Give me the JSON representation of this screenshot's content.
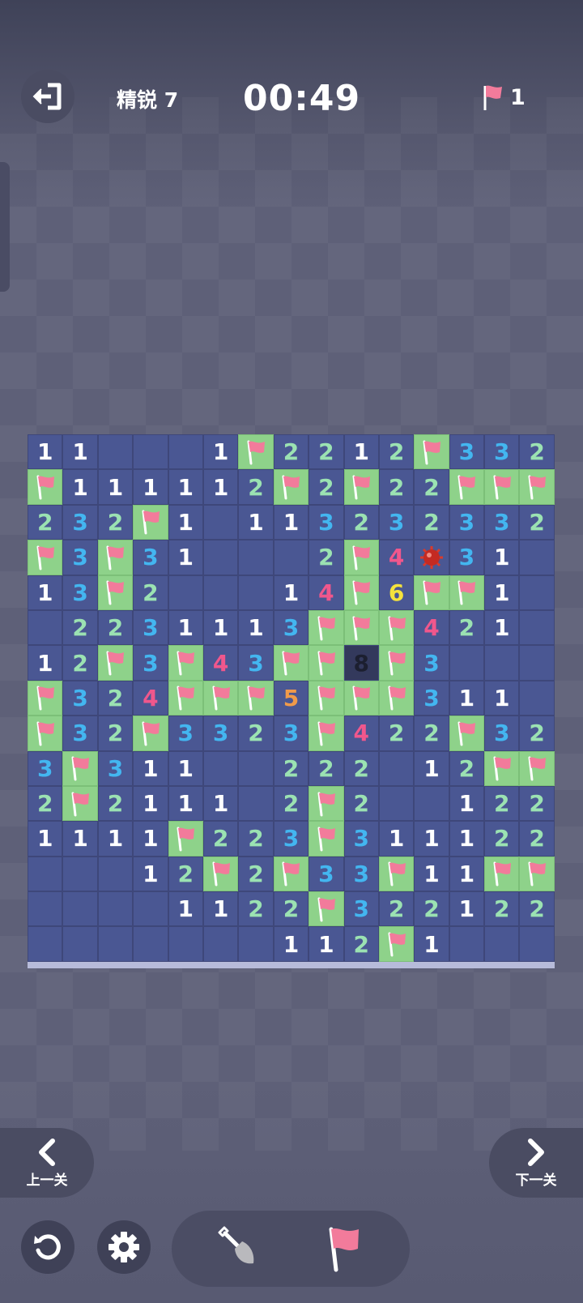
{
  "header": {
    "level_label": "精锐 7",
    "timer": "00:49",
    "flag_count": "1"
  },
  "nav": {
    "prev_label": "上一关",
    "next_label": "下一关"
  },
  "colors": {
    "board": "#4a5793",
    "flag_cell": "#8ed28a",
    "n1": "#ffffff",
    "n2": "#9be2b2",
    "n3": "#43b6f0",
    "n4": "#f0578c",
    "n5": "#f09a4a",
    "n6": "#f5e23c",
    "n8": "#1c1f30"
  },
  "board": {
    "rows": [
      [
        "1",
        "1",
        "",
        "",
        "",
        "1",
        "F",
        "2",
        "2",
        "1",
        "2",
        "F",
        "3",
        "3",
        "2"
      ],
      [
        "F",
        "1",
        "1",
        "1",
        "1",
        "1",
        "2",
        "F",
        "2",
        "F",
        "2",
        "2",
        "F",
        "F",
        "F"
      ],
      [
        "2",
        "3",
        "2",
        "F",
        "1",
        "",
        "1",
        "1",
        "3",
        "2",
        "3",
        "2",
        "3",
        "3",
        "2"
      ],
      [
        "F",
        "3",
        "F",
        "3",
        "1",
        "",
        "",
        "",
        "2",
        "F",
        "4",
        "M",
        "3",
        "1",
        ""
      ],
      [
        "1",
        "3",
        "F",
        "2",
        "",
        "",
        "",
        "1",
        "4",
        "F",
        "6",
        "F",
        "F",
        "1",
        ""
      ],
      [
        "",
        "2",
        "2",
        "3",
        "1",
        "1",
        "1",
        "3",
        "F",
        "F",
        "F",
        "4",
        "2",
        "1",
        ""
      ],
      [
        "1",
        "2",
        "F",
        "3",
        "F",
        "4",
        "3",
        "F",
        "F",
        "8",
        "F",
        "3",
        "",
        "",
        ""
      ],
      [
        "F",
        "3",
        "2",
        "4",
        "F",
        "F",
        "F",
        "5",
        "F",
        "F",
        "F",
        "3",
        "1",
        "1",
        ""
      ],
      [
        "F",
        "3",
        "2",
        "F",
        "3",
        "3",
        "2",
        "3",
        "F",
        "4",
        "2",
        "2",
        "F",
        "3",
        "2"
      ],
      [
        "3",
        "F",
        "3",
        "1",
        "1",
        "",
        "",
        "2",
        "2",
        "2",
        "",
        "1",
        "2",
        "F",
        "F"
      ],
      [
        "2",
        "F",
        "2",
        "1",
        "1",
        "1",
        "",
        "2",
        "F",
        "2",
        "",
        "",
        "1",
        "2",
        "2"
      ],
      [
        "1",
        "1",
        "1",
        "1",
        "F",
        "2",
        "2",
        "3",
        "F",
        "3",
        "1",
        "1",
        "1",
        "2",
        "2"
      ],
      [
        "",
        "",
        "",
        "1",
        "2",
        "F",
        "2",
        "F",
        "3",
        "3",
        "F",
        "1",
        "1",
        "F",
        "F"
      ],
      [
        "",
        "",
        "",
        "",
        "1",
        "1",
        "2",
        "2",
        "F",
        "3",
        "2",
        "2",
        "1",
        "2",
        "2"
      ],
      [
        "",
        "",
        "",
        "",
        "",
        "",
        "",
        "1",
        "1",
        "2",
        "F",
        "1",
        "",
        "",
        ""
      ]
    ]
  },
  "tools": {
    "dig": "shovel-icon",
    "flag": "flag-icon"
  }
}
